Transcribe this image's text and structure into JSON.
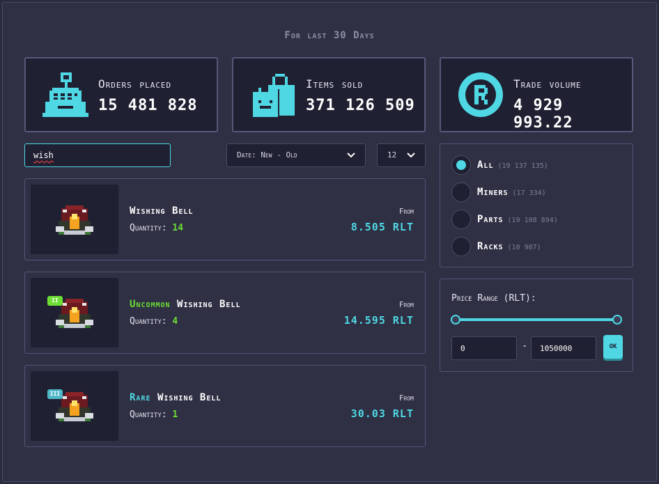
{
  "header": {
    "period": "For last 30 Days"
  },
  "stats": [
    {
      "label": "Orders placed",
      "value": "15 481 828",
      "icon": "cash-register-icon"
    },
    {
      "label": "Items sold",
      "value": "371 126 509",
      "icon": "shopping-bags-icon"
    },
    {
      "label": "Trade volume",
      "value": "4 929 993.22",
      "icon": "rlt-coin-icon"
    }
  ],
  "search": {
    "value": "wish"
  },
  "sort": {
    "selected": "Date: New - Old"
  },
  "per_page": {
    "selected": "12"
  },
  "listings": [
    {
      "rarity": "",
      "name": "Wishing Bell",
      "quantity_label": "Quantity:",
      "quantity": "14",
      "from_label": "From",
      "price": "8.505 RLT",
      "tier": ""
    },
    {
      "rarity": "Uncommon",
      "name": "Wishing Bell",
      "quantity_label": "Quantity:",
      "quantity": "4",
      "from_label": "From",
      "price": "14.595 RLT",
      "tier": "II"
    },
    {
      "rarity": "Rare",
      "name": "Wishing Bell",
      "quantity_label": "Quantity:",
      "quantity": "1",
      "from_label": "From",
      "price": "30.03 RLT",
      "tier": "III"
    }
  ],
  "categories": [
    {
      "label": "All",
      "count": "(19 137 135)",
      "selected": true
    },
    {
      "label": "Miners",
      "count": "(17 334)",
      "selected": false
    },
    {
      "label": "Parts",
      "count": "(19 108 894)",
      "selected": false
    },
    {
      "label": "Racks",
      "count": "(10 907)",
      "selected": false
    }
  ],
  "price_range": {
    "title": "Price Range (RLT):",
    "min": "0",
    "max": "1050000",
    "separator": "-",
    "ok_label": "OK",
    "slider_low": 0.0,
    "slider_high": 1.0
  },
  "colors": {
    "accent": "#4fd8e4",
    "uncommon": "#6dde34",
    "rare": "#4fd8e4",
    "panel": "#1f2032",
    "background": "#2f3044"
  }
}
